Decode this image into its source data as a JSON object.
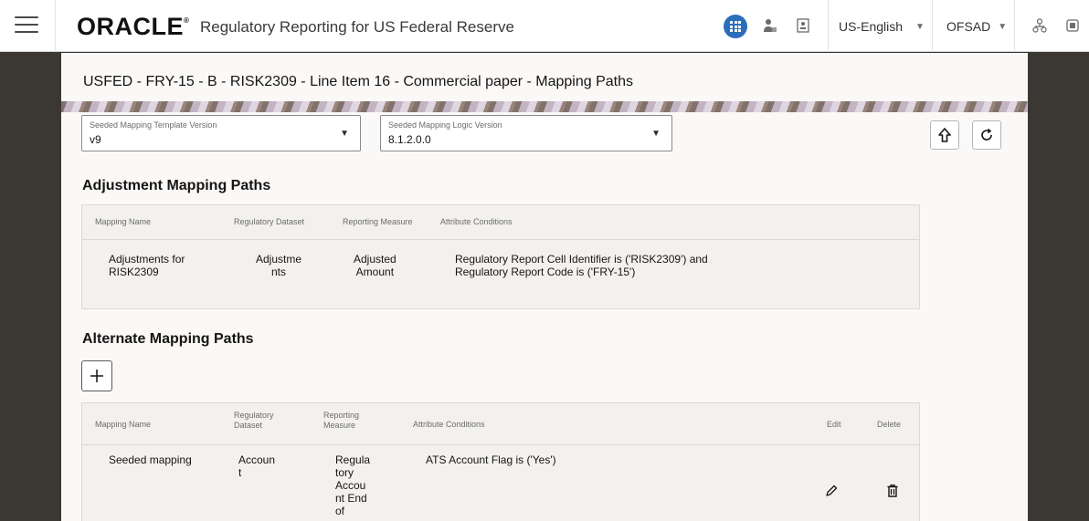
{
  "header": {
    "logo_text": "ORACLE",
    "logo_mark": "®",
    "app_title": "Regulatory Reporting for US Federal Reserve",
    "language": "US-English",
    "user": "OFSAD",
    "icons": [
      "hamburger-menu-icon",
      "apps-grid-icon",
      "user-role-icon",
      "contact-card-icon",
      "network-icon",
      "window-icon"
    ],
    "accent_color": "#2a6ebb"
  },
  "page": {
    "title": "USFED - FRY-15 - B - RISK2309 - Line Item 16 - Commercial paper - Mapping Paths"
  },
  "filters": {
    "template_version_label": "Seeded Mapping Template Version",
    "template_version_value": "v9",
    "logic_version_label": "Seeded Mapping Logic Version",
    "logic_version_value": "8.1.2.0.0"
  },
  "adjustment": {
    "title": "Adjustment Mapping Paths",
    "headers": [
      "Mapping Name",
      "Regulatory Dataset",
      "Reporting Measure",
      "Attribute Conditions"
    ],
    "row": {
      "mapping_name_1": "Adjustments for",
      "mapping_name_2": "RISK2309",
      "dataset_1": "Adjustme",
      "dataset_2": "nts",
      "measure_1": "Adjusted",
      "measure_2": "Amount",
      "conditions_1": "Regulatory Report Cell Identifier is ('RISK2309') and",
      "conditions_2": "Regulatory Report Code is ('FRY-15')"
    }
  },
  "alternate": {
    "title": "Alternate Mapping Paths",
    "add_label": "+",
    "headers": {
      "mapping_name": "Mapping Name",
      "dataset_1": "Regulatory",
      "dataset_2": "Dataset",
      "measure_1": "Reporting",
      "measure_2": "Measure",
      "conditions": "Attribute Conditions",
      "edit": "Edit",
      "delete": "Delete"
    },
    "row": {
      "mapping_name": "Seeded mapping",
      "dataset_1": "Accoun",
      "dataset_2": "t",
      "measure_1": "Regula",
      "measure_2": "tory",
      "measure_3": "Accou",
      "measure_4": "nt End",
      "measure_5": "of",
      "conditions": "ATS Account Flag is ('Yes')"
    }
  }
}
